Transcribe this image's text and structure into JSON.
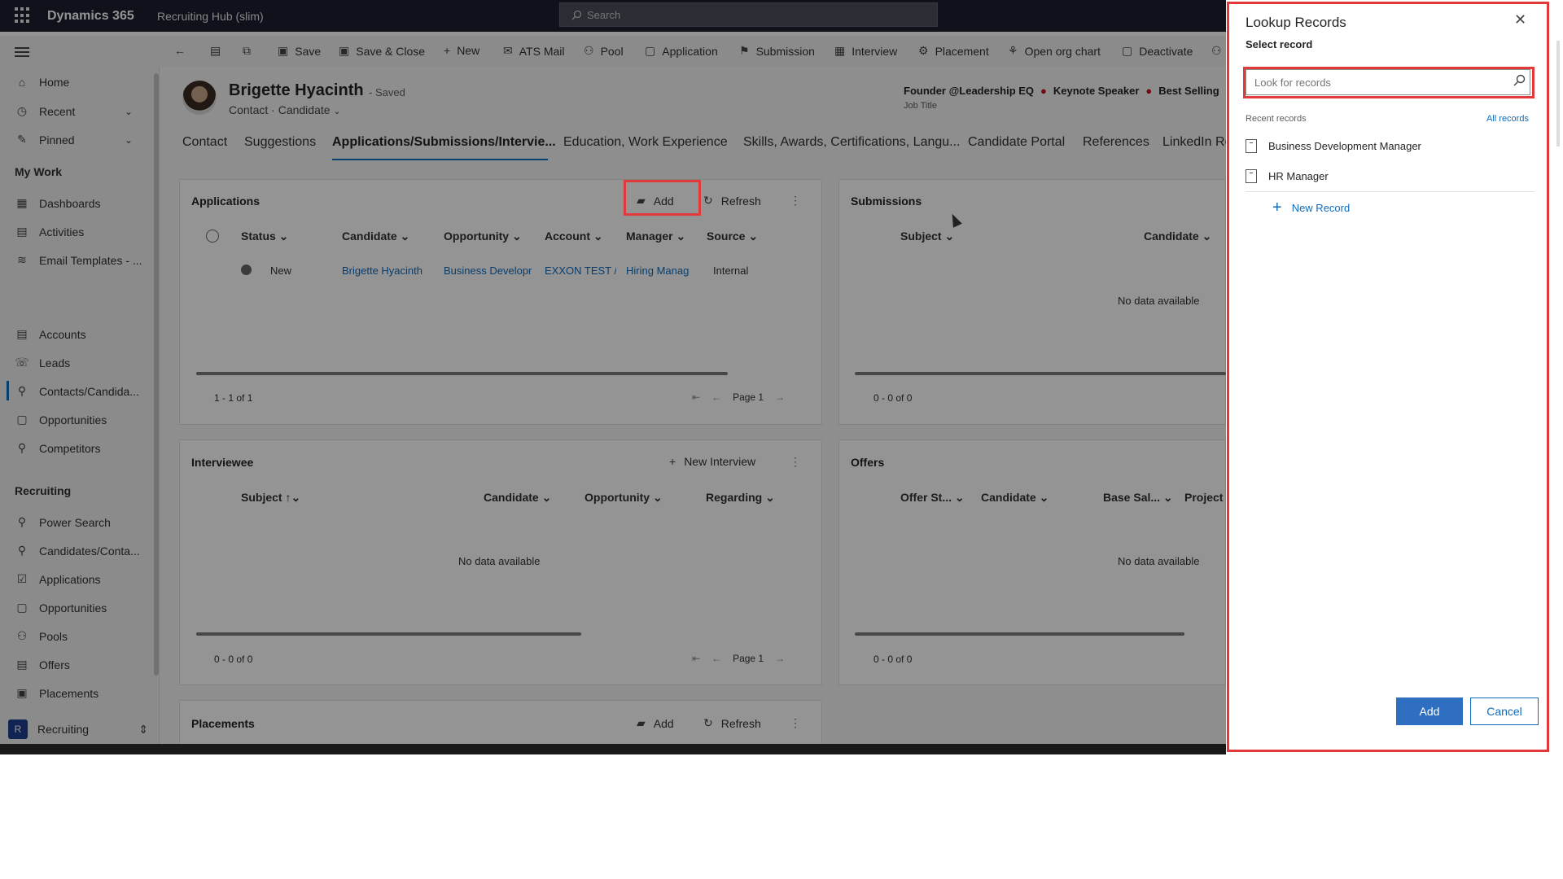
{
  "topbar": {
    "brand": "Dynamics 365",
    "app_name": "Recruiting Hub (slim)",
    "search_placeholder": "Search"
  },
  "commands": [
    "Save",
    "Save & Close",
    "New",
    "ATS Mail",
    "Pool",
    "Application",
    "Submission",
    "Interview",
    "Placement",
    "Open org chart",
    "Deactivate"
  ],
  "sidebar": {
    "top": [
      "Home",
      "Recent",
      "Pinned"
    ],
    "my_work_header": "My Work",
    "my_work": [
      "Dashboards",
      "Activities",
      "Email Templates - ..."
    ],
    "entities": [
      "Accounts",
      "Leads",
      "Contacts/Candida...",
      "Opportunities",
      "Competitors"
    ],
    "recruiting_header": "Recruiting",
    "recruiting": [
      "Power Search",
      "Candidates/Conta...",
      "Applications",
      "Opportunities",
      "Pools",
      "Offers",
      "Placements"
    ],
    "area_badge": "R",
    "area_name": "Recruiting"
  },
  "record": {
    "name": "Brigette Hyacinth",
    "saved": "- Saved",
    "type": "Contact",
    "form": "Candidate",
    "job_title": "Founder @Leadership EQ",
    "headline_2": "Keynote Speaker",
    "headline_3": "Best Selling",
    "job_title_label": "Job Title"
  },
  "tabs": [
    "Contact",
    "Suggestions",
    "Applications/Submissions/Intervie...",
    "Education, Work Experience",
    "Skills, Awards, Certifications, Langu...",
    "Candidate Portal",
    "References",
    "LinkedIn Re"
  ],
  "applications": {
    "title": "Applications",
    "add": "Add",
    "refresh": "Refresh",
    "columns": [
      "Status",
      "Candidate",
      "Opportunity",
      "Account",
      "Manager",
      "Source"
    ],
    "row": {
      "status": "New",
      "candidate": "Brigette Hyacinth",
      "opportunity": "Business Developr",
      "account": "EXXON TEST /",
      "manager": "Hiring Manag",
      "source": "Internal"
    },
    "count": "1 - 1 of 1",
    "page": "Page 1"
  },
  "submissions": {
    "title": "Submissions",
    "columns": [
      "Subject",
      "Candidate"
    ],
    "no_data": "No data available",
    "count": "0 - 0 of 0"
  },
  "interviewee": {
    "title": "Interviewee",
    "new": "New Interview",
    "columns": [
      "Subject",
      "Candidate",
      "Opportunity",
      "Regarding"
    ],
    "no_data": "No data available",
    "count": "0 - 0 of 0",
    "page": "Page 1"
  },
  "offers": {
    "title": "Offers",
    "columns": [
      "Offer St...",
      "Candidate",
      "Base Sal...",
      "Project"
    ],
    "no_data": "No data available",
    "count": "0 - 0 of 0"
  },
  "placements": {
    "title": "Placements",
    "add": "Add",
    "refresh": "Refresh"
  },
  "lookup": {
    "title": "Lookup Records",
    "subtitle": "Select record",
    "placeholder": "Look for records",
    "recent_label": "Recent records",
    "all_records": "All records",
    "items": [
      "Business Development Manager",
      "HR Manager"
    ],
    "new_record": "New Record",
    "add": "Add",
    "cancel": "Cancel"
  },
  "colors": {
    "accent": "#0f6cbd",
    "topbar": "#1c2030",
    "highlight": "#e23a3a"
  }
}
